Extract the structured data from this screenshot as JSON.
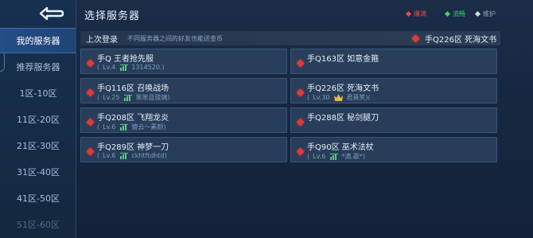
{
  "header": {
    "title": "选择服务器",
    "legend": {
      "full": "爆满",
      "smooth": "流畅",
      "maintenance": "维护"
    }
  },
  "sidebar": {
    "items": [
      {
        "label": "我的服务器"
      },
      {
        "label": "推荐服务器"
      },
      {
        "label": "1区-10区"
      },
      {
        "label": "11区-20区"
      },
      {
        "label": "21区-30区"
      },
      {
        "label": "31区-40区"
      },
      {
        "label": "41区-50区"
      },
      {
        "label": "51区-60区"
      }
    ]
  },
  "last_login": {
    "label": "上次登录",
    "note": "不同服务器之间的好友也能送金币",
    "server": "手Q226区 死海文书"
  },
  "servers": [
    {
      "name": "手Q 王者抢先服",
      "level": "Lv.4",
      "player": "1314520.)",
      "rank_icon": "rank-bars-icon"
    },
    {
      "name": "手Q163区 如意金箍",
      "level": "",
      "player": ""
    },
    {
      "name": "手Q116区 召唤战场",
      "level": "Lv.25",
      "player": "笨笨且琉璃)",
      "rank_icon": "rank-bars-icon"
    },
    {
      "name": "手Q226区 死海文书",
      "level": "Lv.30",
      "player": "君莫笑)(",
      "rank_icon": "crown-icon"
    },
    {
      "name": "手Q208区 飞翔龙炎",
      "level": "Lv.6",
      "player": "貔云～素颜)",
      "rank_icon": "rank-bars-icon"
    },
    {
      "name": "手Q288区 秘剑腿刀",
      "level": "",
      "player": ""
    },
    {
      "name": "手Q289区 神梦一刀",
      "level": "Lv.6",
      "player": "ckhtftdhtd)",
      "rank_icon": "rank-bars-icon"
    },
    {
      "name": "手Q90区 巫术法杖",
      "level": "Lv.6",
      "player": "*滴.歌*)",
      "rank_icon": "rank-bars-icon"
    }
  ],
  "colors": {
    "full": "#e24b4b",
    "smooth": "#3fd16b",
    "maintenance": "#d7dde6",
    "active_nav": "#254d86"
  }
}
